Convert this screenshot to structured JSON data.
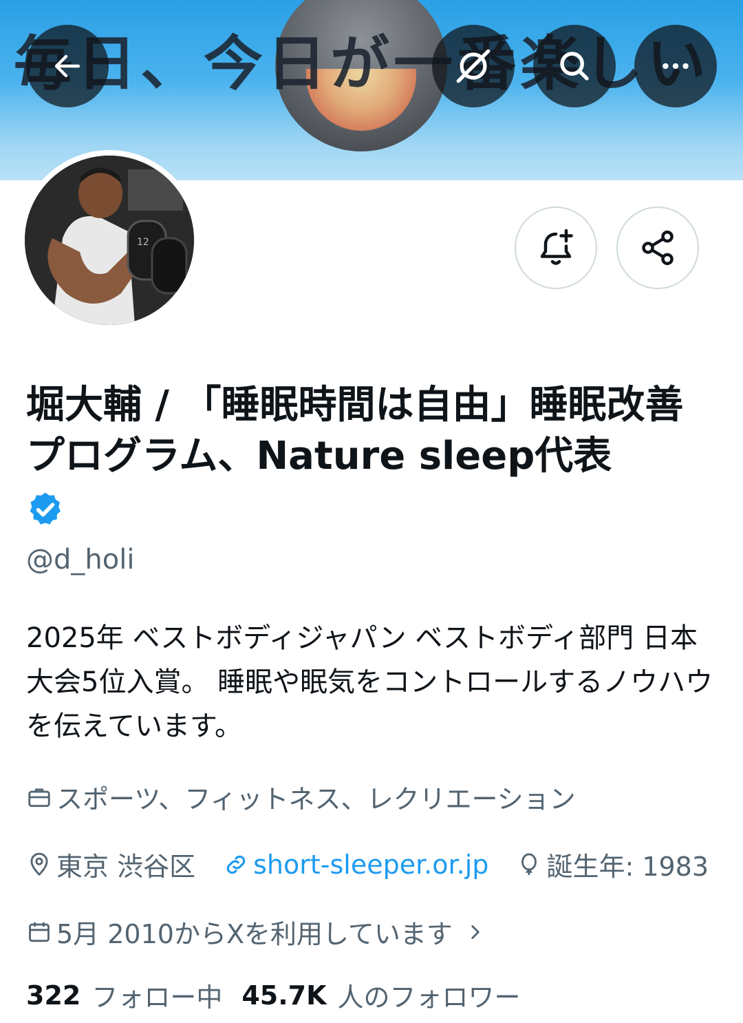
{
  "banner": {
    "text": "毎日、今日が一番楽しい"
  },
  "header_buttons": {
    "back_icon": "arrow-left-icon",
    "grok_icon": "grok-icon",
    "search_icon": "search-icon",
    "more_icon": "more-horizontal-icon"
  },
  "actions": {
    "notify_icon": "bell-plus-icon",
    "share_icon": "share-icon"
  },
  "profile": {
    "display_name": "堀大輔 / 「睡眠時間は自由」睡眠改善プログラム、Nature sleep代表",
    "verified": true,
    "handle": "@d_holi",
    "bio": "2025年 ベストボディジャパン ベストボディ部門 日本大会5位入賞。 睡眠や眠気をコントロールするノウハウを伝えています。",
    "category": "スポーツ、フィットネス、レクリエーション",
    "location": "東京 渋谷区",
    "website": "short-sleeper.or.jp",
    "birth": "誕生年: 1983",
    "joined": "5月 2010からXを利用しています",
    "following_count": "322",
    "following_label": "フォロー中",
    "followers_count": "45.7K",
    "followers_label": "人のフォロワー"
  },
  "colors": {
    "accent": "#1d9bf0",
    "secondary_text": "#536471",
    "primary_text": "#0f1419",
    "border": "#cfd9de"
  }
}
